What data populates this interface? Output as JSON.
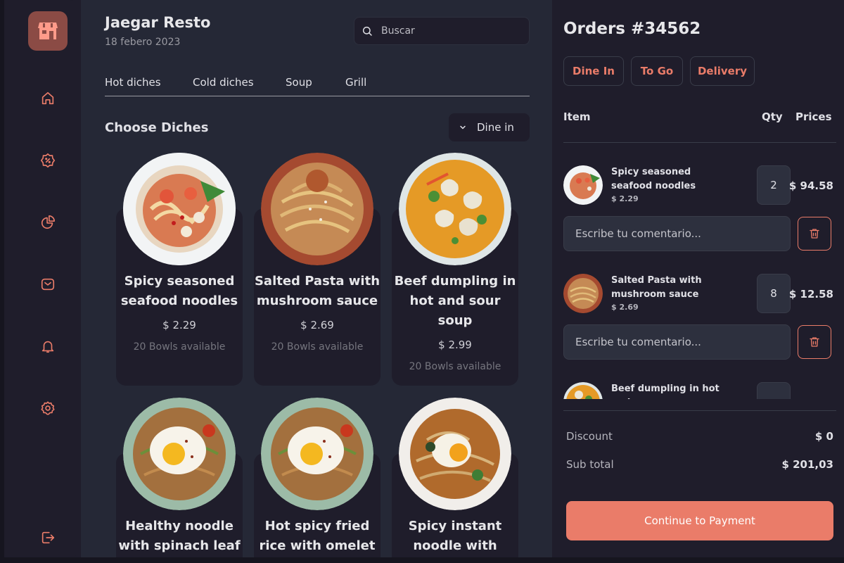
{
  "app": {
    "title": "Jaegar Resto",
    "date": "18 febero 2023"
  },
  "search": {
    "placeholder": "Buscar"
  },
  "tabs": [
    {
      "label": "Hot diches"
    },
    {
      "label": "Cold diches"
    },
    {
      "label": "Soup"
    },
    {
      "label": "Grill"
    }
  ],
  "section": {
    "title": "Choose Diches",
    "filter_label": "Dine in"
  },
  "sidebar": {
    "items": [
      {
        "icon": "home-icon"
      },
      {
        "icon": "discount-icon"
      },
      {
        "icon": "pie-chart-icon"
      },
      {
        "icon": "mail-icon"
      },
      {
        "icon": "bell-icon"
      },
      {
        "icon": "settings-icon"
      },
      {
        "icon": "logout-icon"
      }
    ]
  },
  "dishes": [
    {
      "name": "Spicy seasoned seafood noodles",
      "price": "$ 2.29",
      "availability": "20 Bowls available"
    },
    {
      "name": "Salted Pasta with mushroom sauce",
      "price": "$ 2.69",
      "availability": "20 Bowls available"
    },
    {
      "name": "Beef dumpling in hot and sour soup",
      "price": "$ 2.99",
      "availability": "20 Bowls available"
    },
    {
      "name": "Healthy noodle with spinach leaf"
    },
    {
      "name": "Hot spicy fried rice with omelet"
    },
    {
      "name": "Spicy instant noodle with"
    }
  ],
  "orders": {
    "title": "Orders #34562",
    "types": [
      {
        "label": "Dine In"
      },
      {
        "label": "To Go"
      },
      {
        "label": "Delivery"
      }
    ],
    "columns": {
      "item": "Item",
      "qty": "Qty",
      "prices": "Prices"
    },
    "items": [
      {
        "name": "Spicy seasoned seafood noodles",
        "unit_price": "$ 2.29",
        "qty": "2",
        "total": "$ 94.58"
      },
      {
        "name": "Salted Pasta with mushroom sauce",
        "unit_price": "$ 2.69",
        "qty": "8",
        "total": "$ 12.58"
      },
      {
        "name": "Beef dumpling in hot and",
        "unit_price": "",
        "qty": "",
        "total": ""
      }
    ],
    "comment_placeholder": "Escribe tu comentario...",
    "discount_label": "Discount",
    "discount_value": "$ 0",
    "subtotal_label": "Sub total",
    "subtotal_value": "$ 201,03",
    "pay_label": "Continue to Payment"
  },
  "colors": {
    "accent": "#ea7c69",
    "bg_dark": "#1f1d2b",
    "bg_main": "#252836",
    "field_bg": "#2d303e",
    "border": "#393c49"
  }
}
